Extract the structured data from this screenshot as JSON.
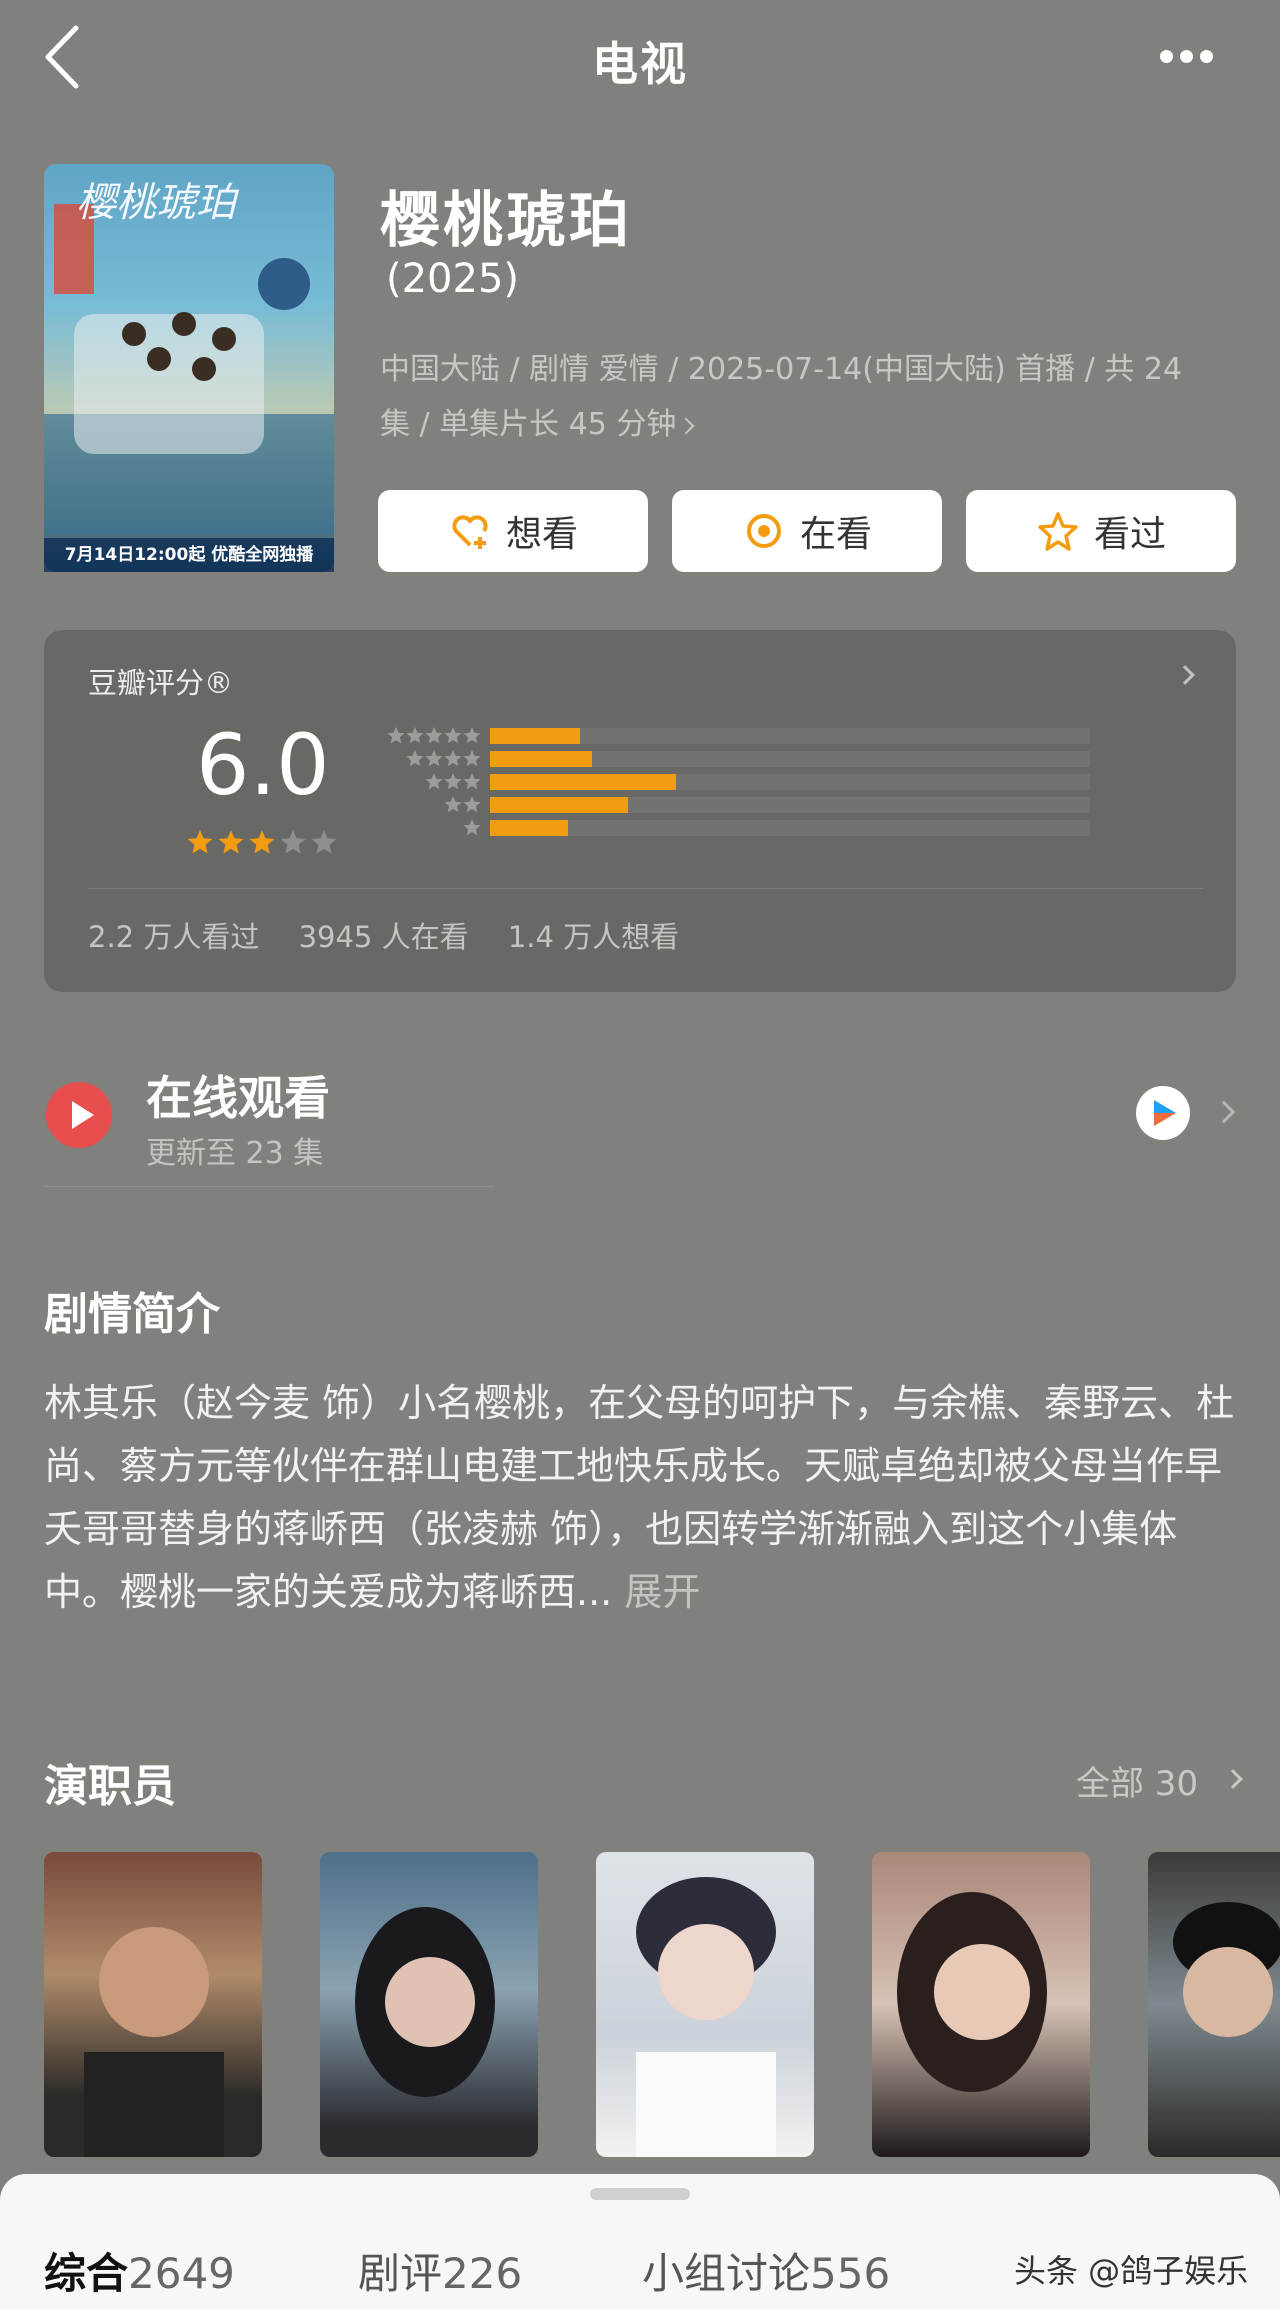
{
  "header": {
    "title": "电视",
    "back_icon": "chevron-left-icon",
    "more_icon": "more-dots-icon"
  },
  "show": {
    "poster_logo": "樱桃琥珀",
    "poster_caption": "7月14日12:00起 优酷全网独播",
    "title": "樱桃琥珀",
    "year": "(2025)",
    "meta_line1": "中国大陆 / 剧情 爱情 / 2025-07-14(中国大陆) 首播 / 共 24",
    "meta_line2": "集 / 单集片长 45 分钟"
  },
  "actions": [
    {
      "label": "想看",
      "icon": "heart-plus-icon"
    },
    {
      "label": "在看",
      "icon": "watching-icon"
    },
    {
      "label": "看过",
      "icon": "star-icon"
    }
  ],
  "rating": {
    "label": "豆瓣评分®",
    "score": "6.0",
    "stars": 3,
    "distribution": [
      {
        "stars": 5,
        "fraction": 0.15
      },
      {
        "stars": 4,
        "fraction": 0.17
      },
      {
        "stars": 3,
        "fraction": 0.31
      },
      {
        "stars": 2,
        "fraction": 0.23
      },
      {
        "stars": 1,
        "fraction": 0.13
      }
    ],
    "stats": [
      "2.2 万人看过",
      "3945 人在看",
      "1.4 万人想看"
    ],
    "colors": {
      "accent": "#f39c12",
      "empty_star": "#8f908b"
    }
  },
  "watch": {
    "title": "在线观看",
    "subtitle": "更新至 23 集",
    "platform_icon": "youku-icon"
  },
  "synopsis": {
    "title": "剧情简介",
    "text": "林其乐（赵今麦 饰）小名樱桃，在父母的呵护下，与余樵、秦野云、杜尚、蔡方元等伙伴在群山电建工地快乐成长。天赋卓绝却被父母当作早夭哥哥替身的蒋峤西（张凌赫 饰），也因转学渐渐融入到这个小集体中。樱桃一家的关爱成为蒋峤西...",
    "expand": "展开"
  },
  "cast": {
    "title": "演职员",
    "all_label": "全部 30",
    "members": [
      {
        "name": "cast-member-1"
      },
      {
        "name": "cast-member-2"
      },
      {
        "name": "cast-member-3"
      },
      {
        "name": "cast-member-4"
      },
      {
        "name": "cast-member-5"
      }
    ]
  },
  "tabs": [
    {
      "label": "综合",
      "count": "2649",
      "active": true
    },
    {
      "label": "剧评",
      "count": "226",
      "active": false
    },
    {
      "label": "小组讨论",
      "count": "556",
      "active": false
    }
  ],
  "watermark": "头条 @鸽子娱乐"
}
